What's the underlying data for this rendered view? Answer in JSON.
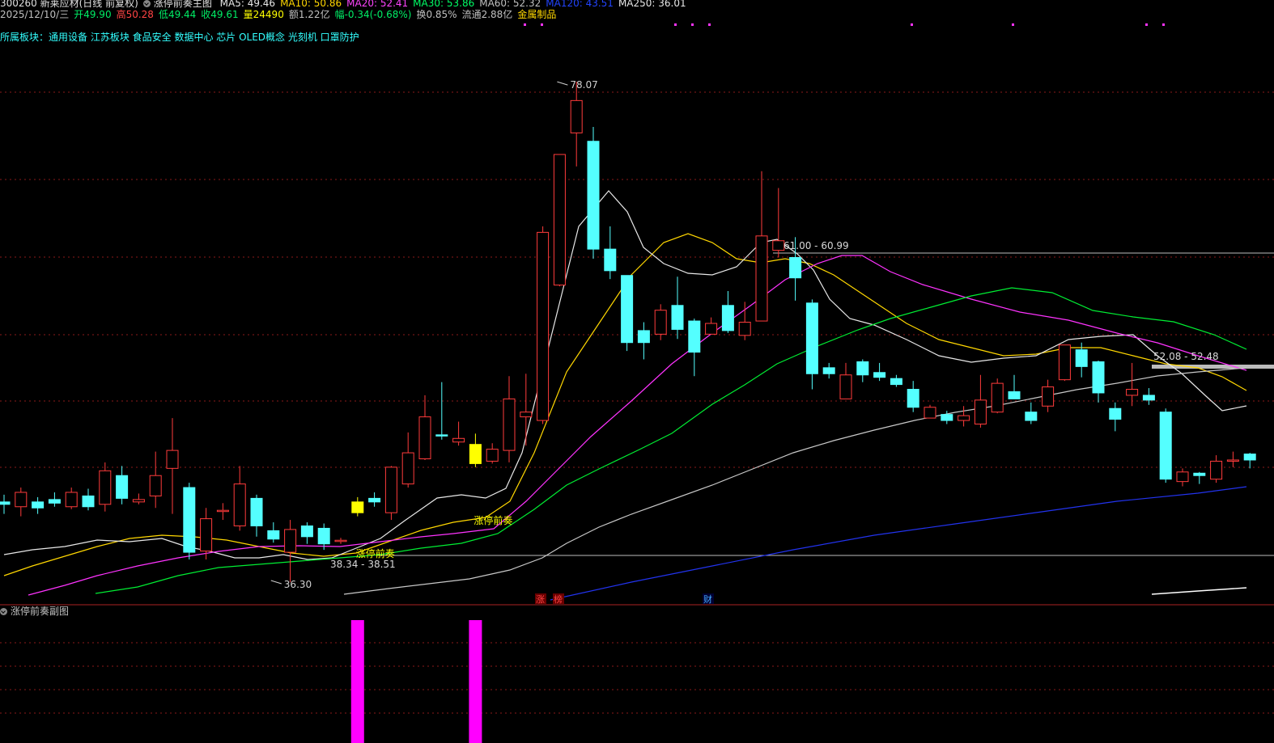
{
  "header": {
    "stock": "300260 新莱应材(日线 前复权)",
    "indicator": "涨停前奏主图",
    "ma": [
      {
        "label": "MA5: 49.46",
        "color": "#e8e8e8"
      },
      {
        "label": "MA10: 50.86",
        "color": "#ffd700"
      },
      {
        "label": "MA20: 52.41",
        "color": "#ff44ff"
      },
      {
        "label": "MA30: 53.86",
        "color": "#00ff66"
      },
      {
        "label": "MA60: 52.32",
        "color": "#c0c0c0"
      },
      {
        "label": "MA120: 43.51",
        "color": "#2244ff"
      },
      {
        "label": "MA250: 36.01",
        "color": "#e8e8e8"
      }
    ],
    "quote": [
      {
        "label": "2025/12/10/三",
        "color": "#c0c0c0"
      },
      {
        "label": "开49.90",
        "color": "#00ee66"
      },
      {
        "label": "高50.28",
        "color": "#ff4444"
      },
      {
        "label": "低49.44",
        "color": "#00ee66"
      },
      {
        "label": "收49.61",
        "color": "#00ee66"
      },
      {
        "label": "量24490",
        "color": "#ffff00"
      },
      {
        "label": "额1.22亿",
        "color": "#c0c0c0"
      },
      {
        "label": "幅-0.34(-0.68%)",
        "color": "#00ee66"
      },
      {
        "label": "换0.85%",
        "color": "#c0c0c0"
      },
      {
        "label": "流通2.88亿",
        "color": "#c0c0c0"
      },
      {
        "label": "金属制品",
        "color": "#ffd700"
      }
    ],
    "sectors": "所属板块：通用设备 江苏板块 食品安全 数据中心 芯片 OLED概念 光刻机 口罩防护"
  },
  "annotations": {
    "high": "78.07",
    "low": "36.30",
    "range1": "61.00 - 60.99",
    "range2": "52.08 - 52.48",
    "range3": "38.34 - 38.51",
    "signal": "涨停前奏",
    "evt_zhang": "涨",
    "evt_bang": "榜",
    "evt_cai": "财"
  },
  "sub_chart": {
    "title": "涨停前奏副图"
  },
  "colors": {
    "up": "#ff3b3b",
    "down": "#54ffff",
    "signal": "#ffff00",
    "sub_bar": "#ff00ff",
    "grid": "#8b1a1a",
    "ma5": "#e8e8e8",
    "ma10": "#ffd700",
    "ma20": "#ff33ff",
    "ma30": "#00ee33",
    "ma60": "#c8c8c8",
    "ma120": "#2233ee",
    "ma250": "#ffffff"
  },
  "chart_data": {
    "type": "candlestick",
    "candles": [
      [
        43.0,
        42.8,
        43.6,
        42.0
      ],
      [
        42.6,
        43.8,
        44.2,
        41.8
      ],
      [
        43.0,
        42.5,
        43.4,
        42.0
      ],
      [
        43.2,
        42.9,
        43.8,
        42.6
      ],
      [
        42.6,
        43.8,
        44.2,
        42.4
      ],
      [
        43.5,
        42.6,
        44.1,
        42.3
      ],
      [
        42.8,
        45.6,
        46.3,
        42.2
      ],
      [
        45.2,
        43.3,
        46.0,
        42.8
      ],
      [
        43.0,
        43.2,
        43.7,
        42.8
      ],
      [
        43.5,
        45.2,
        47.2,
        42.5
      ],
      [
        45.8,
        47.3,
        50.0,
        42.0
      ],
      [
        44.2,
        38.8,
        44.6,
        38.2
      ],
      [
        38.9,
        41.6,
        42.5,
        38.2
      ],
      [
        42.2,
        42.3,
        42.9,
        41.5
      ],
      [
        41.0,
        44.5,
        46.0,
        40.6
      ],
      [
        43.3,
        41.0,
        43.6,
        40.1
      ],
      [
        40.6,
        39.9,
        41.3,
        39.6
      ],
      [
        38.8,
        40.7,
        41.5,
        36.3
      ],
      [
        41.0,
        40.1,
        41.3,
        39.5
      ],
      [
        40.8,
        39.5,
        41.2,
        39.0
      ],
      [
        39.8,
        39.8,
        40.0,
        39.5
      ],
      [
        42.1,
        43.0,
        43.4,
        41.8
      ],
      [
        43.3,
        43.0,
        43.8,
        42.6
      ],
      [
        42.1,
        45.9,
        46.0,
        41.5
      ],
      [
        44.5,
        47.1,
        48.8,
        44.2
      ],
      [
        46.6,
        50.1,
        51.9,
        46.5
      ],
      [
        48.6,
        48.5,
        53.0,
        48.2
      ],
      [
        48.0,
        48.3,
        49.7,
        47.7
      ],
      [
        47.8,
        46.2,
        48.7,
        45.9
      ],
      [
        46.4,
        47.4,
        47.9,
        46.2
      ],
      [
        47.3,
        51.6,
        53.5,
        46.3
      ],
      [
        50.1,
        50.5,
        53.7,
        47.7
      ],
      [
        49.8,
        65.5,
        66.0,
        49.5
      ],
      [
        61.1,
        72.0,
        72.0,
        61.0
      ],
      [
        73.8,
        76.5,
        78.07,
        71.0
      ],
      [
        73.1,
        64.1,
        74.3,
        63.3
      ],
      [
        64.1,
        62.3,
        66.0,
        61.6
      ],
      [
        61.9,
        56.3,
        61.9,
        55.6
      ],
      [
        57.3,
        56.3,
        58.0,
        54.9
      ],
      [
        57.0,
        59.0,
        59.5,
        56.5
      ],
      [
        59.4,
        57.4,
        61.8,
        56.6
      ],
      [
        58.1,
        55.5,
        58.3,
        53.5
      ],
      [
        57.0,
        57.9,
        58.4,
        57.0
      ],
      [
        59.4,
        57.3,
        60.6,
        57.1
      ],
      [
        56.9,
        58.0,
        59.7,
        56.5
      ],
      [
        58.1,
        65.2,
        70.6,
        58.1
      ],
      [
        64.0,
        64.8,
        69.2,
        63.4
      ],
      [
        63.4,
        61.7,
        65.1,
        59.8
      ],
      [
        59.6,
        53.7,
        59.9,
        52.4
      ],
      [
        54.2,
        53.7,
        54.6,
        53.3
      ],
      [
        51.6,
        53.6,
        54.6,
        51.6
      ],
      [
        54.7,
        53.6,
        54.9,
        53.0
      ],
      [
        53.8,
        53.4,
        54.6,
        53.1
      ],
      [
        53.3,
        52.8,
        53.6,
        52.6
      ],
      [
        52.4,
        50.9,
        53.1,
        50.5
      ],
      [
        50.0,
        50.9,
        51.1,
        50.0
      ],
      [
        50.3,
        49.8,
        50.6,
        49.5
      ],
      [
        49.8,
        50.2,
        51.0,
        49.3
      ],
      [
        49.5,
        51.5,
        53.6,
        49.2
      ],
      [
        50.5,
        52.9,
        53.3,
        50.4
      ],
      [
        52.2,
        51.6,
        53.6,
        51.6
      ],
      [
        50.5,
        49.8,
        51.3,
        49.5
      ],
      [
        51.0,
        52.6,
        53.2,
        50.5
      ],
      [
        53.2,
        56.1,
        56.1,
        53.1
      ],
      [
        55.7,
        54.3,
        56.3,
        53.4
      ],
      [
        54.7,
        52.1,
        54.8,
        51.3
      ],
      [
        50.8,
        49.9,
        51.3,
        48.9
      ],
      [
        51.9,
        52.4,
        54.6,
        51.0
      ],
      [
        51.9,
        51.5,
        52.5,
        51.1
      ],
      [
        50.5,
        44.9,
        50.8,
        44.6
      ],
      [
        44.7,
        45.5,
        45.8,
        44.3
      ],
      [
        45.4,
        45.2,
        45.5,
        44.5
      ],
      [
        44.9,
        46.4,
        46.9,
        44.6
      ],
      [
        46.5,
        46.5,
        47.2,
        45.9
      ],
      [
        47.0,
        46.5,
        47.1,
        45.8
      ]
    ],
    "signals": [
      21,
      28
    ],
    "ylim": [
      33,
      78.07
    ]
  }
}
